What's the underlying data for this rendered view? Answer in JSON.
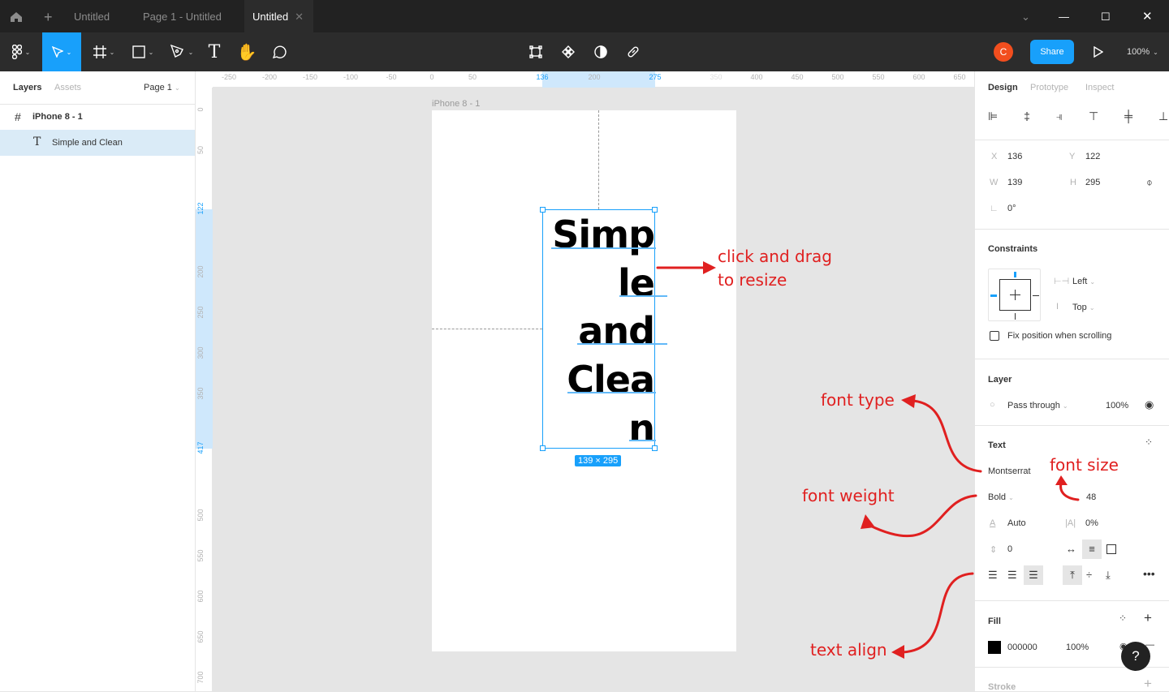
{
  "tabs": {
    "home_icon": "home-icon",
    "new_icon": "plus-icon",
    "items": [
      {
        "label": "Untitled"
      },
      {
        "label": "Page 1 - Untitled"
      },
      {
        "label": "Untitled",
        "active": true
      }
    ]
  },
  "toolbar": {
    "tools": [
      "figma-menu",
      "move",
      "frame",
      "rectangle",
      "pen",
      "text",
      "hand",
      "comment"
    ],
    "avatar_initial": "C",
    "avatar_color": "#f24e1e",
    "share_label": "Share",
    "zoom": "100%",
    "accent": "#18a0fb"
  },
  "layers": {
    "tab_layers": "Layers",
    "tab_assets": "Assets",
    "page": "Page 1",
    "items": [
      {
        "name": "iPhone 8 - 1",
        "type": "frame"
      },
      {
        "name": "Simple and Clean",
        "type": "text",
        "selected": true
      }
    ]
  },
  "rulers": {
    "h": [
      {
        "v": "-250"
      },
      {
        "v": "-200"
      },
      {
        "v": "-150"
      },
      {
        "v": "-100"
      },
      {
        "v": "-50"
      },
      {
        "v": "0"
      },
      {
        "v": "50"
      },
      {
        "v": "136",
        "hl": true
      },
      {
        "v": "200"
      },
      {
        "v": "275",
        "hl": true
      },
      {
        "v": "350"
      },
      {
        "v": "400"
      },
      {
        "v": "450"
      },
      {
        "v": "500"
      },
      {
        "v": "550"
      },
      {
        "v": "600"
      },
      {
        "v": "650"
      }
    ],
    "v": [
      {
        "v": "0"
      },
      {
        "v": "50"
      },
      {
        "v": "122",
        "hl": true
      },
      {
        "v": "200"
      },
      {
        "v": "250"
      },
      {
        "v": "300"
      },
      {
        "v": "350"
      },
      {
        "v": "417",
        "hl": true
      },
      {
        "v": "500"
      },
      {
        "v": "550"
      },
      {
        "v": "600"
      },
      {
        "v": "650"
      },
      {
        "v": "700"
      }
    ]
  },
  "canvas": {
    "frame_label": "iPhone 8 - 1",
    "text_lines": [
      "Simp",
      "le",
      "and",
      "Clea",
      "n"
    ],
    "size_badge": "139 × 295"
  },
  "annotations": {
    "resize": [
      "click and drag",
      "to resize"
    ],
    "font_type": "font type",
    "font_size": "font size",
    "font_weight": "font weight",
    "text_align": "text align",
    "color": "#e02020"
  },
  "design": {
    "tabs": [
      "Design",
      "Prototype",
      "Inspect"
    ],
    "x_label": "X",
    "x": "136",
    "y_label": "Y",
    "y": "122",
    "w_label": "W",
    "w": "139",
    "h_label": "H",
    "h": "295",
    "rotation": "0°",
    "constraints_title": "Constraints",
    "constraint_h": "Left",
    "constraint_v": "Top",
    "fix_position": "Fix position when scrolling",
    "layer_title": "Layer",
    "blend": "Pass through",
    "opacity": "100%",
    "text_title": "Text",
    "font": "Montserrat",
    "weight": "Bold",
    "size": "48",
    "line_height": "Auto",
    "letter_spacing": "0%",
    "paragraph_spacing": "0",
    "fill_title": "Fill",
    "fill_hex": "000000",
    "fill_opacity": "100%",
    "fill_color": "#000000",
    "stroke_title": "Stroke",
    "help": "?"
  }
}
